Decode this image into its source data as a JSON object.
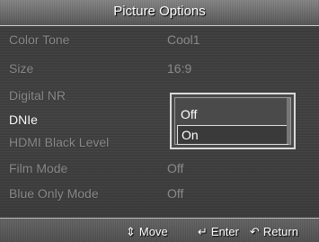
{
  "header": {
    "title": "Picture Options"
  },
  "menu": {
    "items": [
      {
        "label": "Color Tone",
        "value": "Cool1"
      },
      {
        "label": "Size",
        "value": "16:9"
      },
      {
        "label": "Digital NR",
        "value": ""
      },
      {
        "label": "DNIe",
        "value": ""
      },
      {
        "label": "HDMI Black Level",
        "value": ""
      },
      {
        "label": "Film Mode",
        "value": "Off"
      },
      {
        "label": "Blue Only Mode",
        "value": "Off"
      }
    ],
    "active_item": "DNIe"
  },
  "popup": {
    "options": [
      "Off",
      "On"
    ],
    "selected": "On"
  },
  "footer": {
    "move": {
      "icon": "updown-arrows-icon",
      "label": "Move",
      "glyph": "⇕"
    },
    "enter": {
      "icon": "enter-icon",
      "label": "Enter",
      "glyph": "↵"
    },
    "return": {
      "icon": "return-icon",
      "label": "Return",
      "glyph": "↶"
    }
  }
}
